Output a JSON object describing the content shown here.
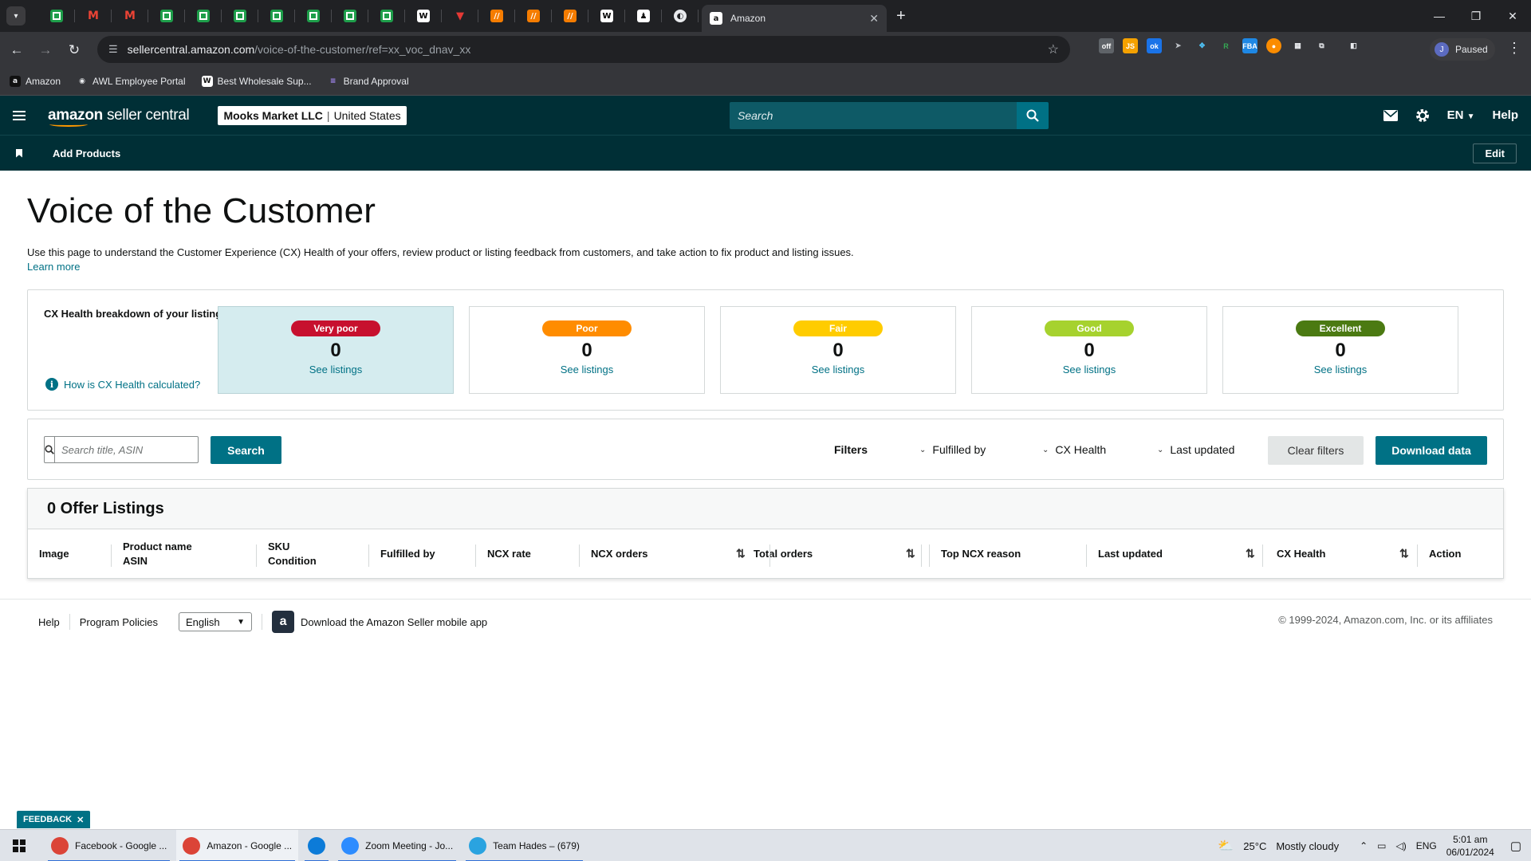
{
  "browser": {
    "mini_tabs": [
      {
        "icon": "sheets-icon",
        "glyph": ""
      },
      {
        "icon": "gmail-icon",
        "glyph": "M"
      },
      {
        "icon": "gmail-icon",
        "glyph": "M"
      },
      {
        "icon": "sheets-icon",
        "glyph": ""
      },
      {
        "icon": "sheets-icon",
        "glyph": ""
      },
      {
        "icon": "sheets-icon",
        "glyph": ""
      },
      {
        "icon": "sheets-icon",
        "glyph": ""
      },
      {
        "icon": "sheets-icon",
        "glyph": ""
      },
      {
        "icon": "sheets-icon",
        "glyph": ""
      },
      {
        "icon": "sheets-icon",
        "glyph": ""
      },
      {
        "icon": "doc-icon",
        "glyph": "W"
      },
      {
        "icon": "red-icon",
        "glyph": "▼"
      },
      {
        "icon": "orange-icon",
        "glyph": "//"
      },
      {
        "icon": "orange-icon",
        "glyph": "//"
      },
      {
        "icon": "orange-icon",
        "glyph": "//"
      },
      {
        "icon": "doc-icon",
        "glyph": "W"
      },
      {
        "icon": "dark-icon",
        "glyph": "♟"
      },
      {
        "icon": "globe-icon",
        "glyph": "◐"
      }
    ],
    "active_tab_title": "Amazon",
    "url_host": "sellercentral.amazon.com",
    "url_path": "/voice-of-the-customer/ref=xx_voc_dnav_xx",
    "profile_initial": "J",
    "profile_status": "Paused",
    "bookmarks": [
      {
        "label": "Amazon",
        "icon": "amazon-icon",
        "glyph": "a"
      },
      {
        "label": "AWL Employee Portal",
        "icon": "portal-icon",
        "glyph": "◉"
      },
      {
        "label": "Best Wholesale Sup...",
        "icon": "wc-icon",
        "glyph": "W"
      },
      {
        "label": "Brand Approval",
        "icon": "list-icon",
        "glyph": "≡"
      }
    ]
  },
  "header": {
    "logo_brand": "amazon",
    "logo_suffix": "seller central",
    "account_name": "Mooks Market LLC",
    "account_region": "United States",
    "search_placeholder": "Search",
    "language": "EN",
    "help": "Help"
  },
  "subbar": {
    "link": "Add Products",
    "edit": "Edit"
  },
  "page": {
    "title": "Voice of the Customer",
    "intro": "Use this page to understand the Customer Experience (CX) Health of your offers, review product or listing feedback from customers, and take action to fix product and listing issues.",
    "learn_more": "Learn more"
  },
  "cx_health": {
    "title": "CX Health breakdown of your listings",
    "help_link": "How is CX Health calculated?",
    "cards": [
      {
        "label": "Very poor",
        "count": "0",
        "link": "See listings",
        "pill_bg": "#c7102e",
        "pill_fg": "#ffffff"
      },
      {
        "label": "Poor",
        "count": "0",
        "link": "See listings",
        "pill_bg": "#ff8c00",
        "pill_fg": "#ffffff"
      },
      {
        "label": "Fair",
        "count": "0",
        "link": "See listings",
        "pill_bg": "#ffcc00",
        "pill_fg": "#ffffff"
      },
      {
        "label": "Good",
        "count": "0",
        "link": "See listings",
        "pill_bg": "#a6d22e",
        "pill_fg": "#ffffff"
      },
      {
        "label": "Excellent",
        "count": "0",
        "link": "See listings",
        "pill_bg": "#4b7a12",
        "pill_fg": "#ffffff"
      }
    ]
  },
  "filters": {
    "search_placeholder": "Search title, ASIN",
    "search_button": "Search",
    "label": "Filters",
    "dropdowns": [
      "Fulfilled by",
      "CX Health",
      "Last updated"
    ],
    "clear": "Clear filters",
    "download": "Download data"
  },
  "listings": {
    "heading": "0 Offer Listings",
    "columns": [
      {
        "line1": "Image",
        "line2": ""
      },
      {
        "line1": "Product name",
        "line2": "ASIN"
      },
      {
        "line1": "SKU",
        "line2": "Condition"
      },
      {
        "line1": "Fulfilled by",
        "line2": ""
      },
      {
        "line1": "NCX rate",
        "line2": ""
      },
      {
        "line1": "NCX orders",
        "line2": ""
      },
      {
        "line1": "Total orders",
        "line2": ""
      },
      {
        "line1": "Top NCX reason",
        "line2": ""
      },
      {
        "line1": "Last updated",
        "line2": ""
      },
      {
        "line1": "CX Health",
        "line2": ""
      },
      {
        "line1": "Action",
        "line2": ""
      }
    ]
  },
  "footer": {
    "help": "Help",
    "policies": "Program Policies",
    "language": "English",
    "app_text": "Download the Amazon Seller mobile app",
    "copyright": "© 1999-2024, Amazon.com, Inc. or its affiliates"
  },
  "feedback": "FEEDBACK",
  "taskbar": {
    "items": [
      {
        "label": "Facebook - Google ...",
        "icon": "chrome-icon",
        "color": "#db4437",
        "active": false
      },
      {
        "label": "Amazon - Google ...",
        "icon": "chrome-icon",
        "color": "#db4437",
        "active": true
      },
      {
        "label": "",
        "icon": "edge-icon",
        "color": "#0c7bd8",
        "active": false
      },
      {
        "label": "Zoom Meeting - Jo...",
        "icon": "zoom-icon",
        "color": "#2d8cff",
        "active": false
      },
      {
        "label": "Team Hades – (679)",
        "icon": "telegram-icon",
        "color": "#2aa3e0",
        "active": false
      }
    ],
    "weather_temp": "25°C",
    "weather_text": "Mostly cloudy",
    "lang": "ENG",
    "time": "5:01 am",
    "date": "06/01/2024"
  }
}
